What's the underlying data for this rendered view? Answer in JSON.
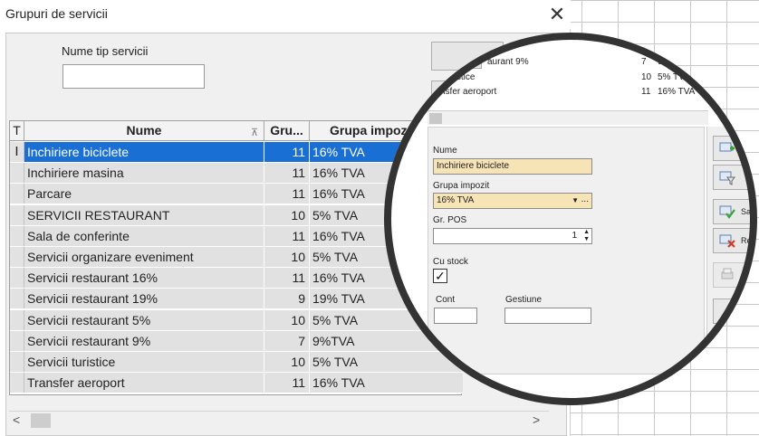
{
  "window": {
    "title": "Grupuri de servicii",
    "close_glyph": "✕"
  },
  "filter": {
    "label": "Nume tip servicii",
    "value": ""
  },
  "table": {
    "headers": {
      "t": "T",
      "nume": "Nume",
      "gru": "Gru...",
      "grupa_impozit": "Grupa impoz"
    },
    "rows": [
      {
        "t": "I",
        "nume": "Inchiriere biciclete",
        "gru": "11",
        "gi": "16% TVA",
        "selected": true
      },
      {
        "t": "",
        "nume": "Inchiriere masina",
        "gru": "11",
        "gi": "16% TVA"
      },
      {
        "t": "",
        "nume": "Parcare",
        "gru": "11",
        "gi": "16% TVA"
      },
      {
        "t": "",
        "nume": "SERVICII RESTAURANT",
        "gru": "10",
        "gi": "5% TVA"
      },
      {
        "t": "",
        "nume": "Sala de conferinte",
        "gru": "11",
        "gi": "16% TVA"
      },
      {
        "t": "",
        "nume": "Servicii organizare eveniment",
        "gru": "10",
        "gi": "5% TVA"
      },
      {
        "t": "",
        "nume": "Servicii restaurant 16%",
        "gru": "11",
        "gi": "16% TVA"
      },
      {
        "t": "",
        "nume": "Servicii restaurant 19%",
        "gru": "9",
        "gi": "19% TVA"
      },
      {
        "t": "",
        "nume": "Servicii restaurant 5%",
        "gru": "10",
        "gi": "5% TVA"
      },
      {
        "t": "",
        "nume": "Servicii restaurant 9%",
        "gru": "7",
        "gi": "9%TVA"
      },
      {
        "t": "",
        "nume": "Servicii turistice",
        "gru": "10",
        "gi": "5% TVA"
      },
      {
        "t": "",
        "nume": "Transfer aeroport",
        "gru": "11",
        "gi": "16% TVA"
      }
    ]
  },
  "scroll": {
    "left": "<",
    "right": ">"
  },
  "lens": {
    "mini_rows": [
      {
        "nume": "",
        "gru": "10",
        "gi": "5% TVA"
      },
      {
        "nume": "aurant 9%",
        "gru": "7",
        "gi": "9%TVA"
      },
      {
        "nume": "turistice",
        "gru": "10",
        "gi": "5% TVA"
      },
      {
        "nume": "nsfer aeroport",
        "gru": "11",
        "gi": "16% TVA"
      }
    ],
    "mini_filter_label": "G",
    "form": {
      "nume_label": "Nume",
      "nume_value": "Inchiriere biciclete",
      "grupa_label": "Grupa impozit",
      "grupa_value": "16% TVA",
      "grupa_arrow": "▼",
      "grupa_more": "...",
      "pos_label": "Gr. POS",
      "pos_value": "1",
      "spin_glyph": "▲▼",
      "stock_label": "Cu stock",
      "stock_checked": "✓",
      "cont_label": "Cont",
      "cont_value": "",
      "gestiune_label": "Gestiune",
      "gestiune_value": ""
    },
    "side_buttons": {
      "save_label": "Sa",
      "remove_label": "Re"
    }
  },
  "colors": {
    "selection": "#1a6fd4",
    "highlight_field": "#f6e3b6",
    "add_green": "#3aa23a",
    "remove_red": "#d23a2a"
  }
}
